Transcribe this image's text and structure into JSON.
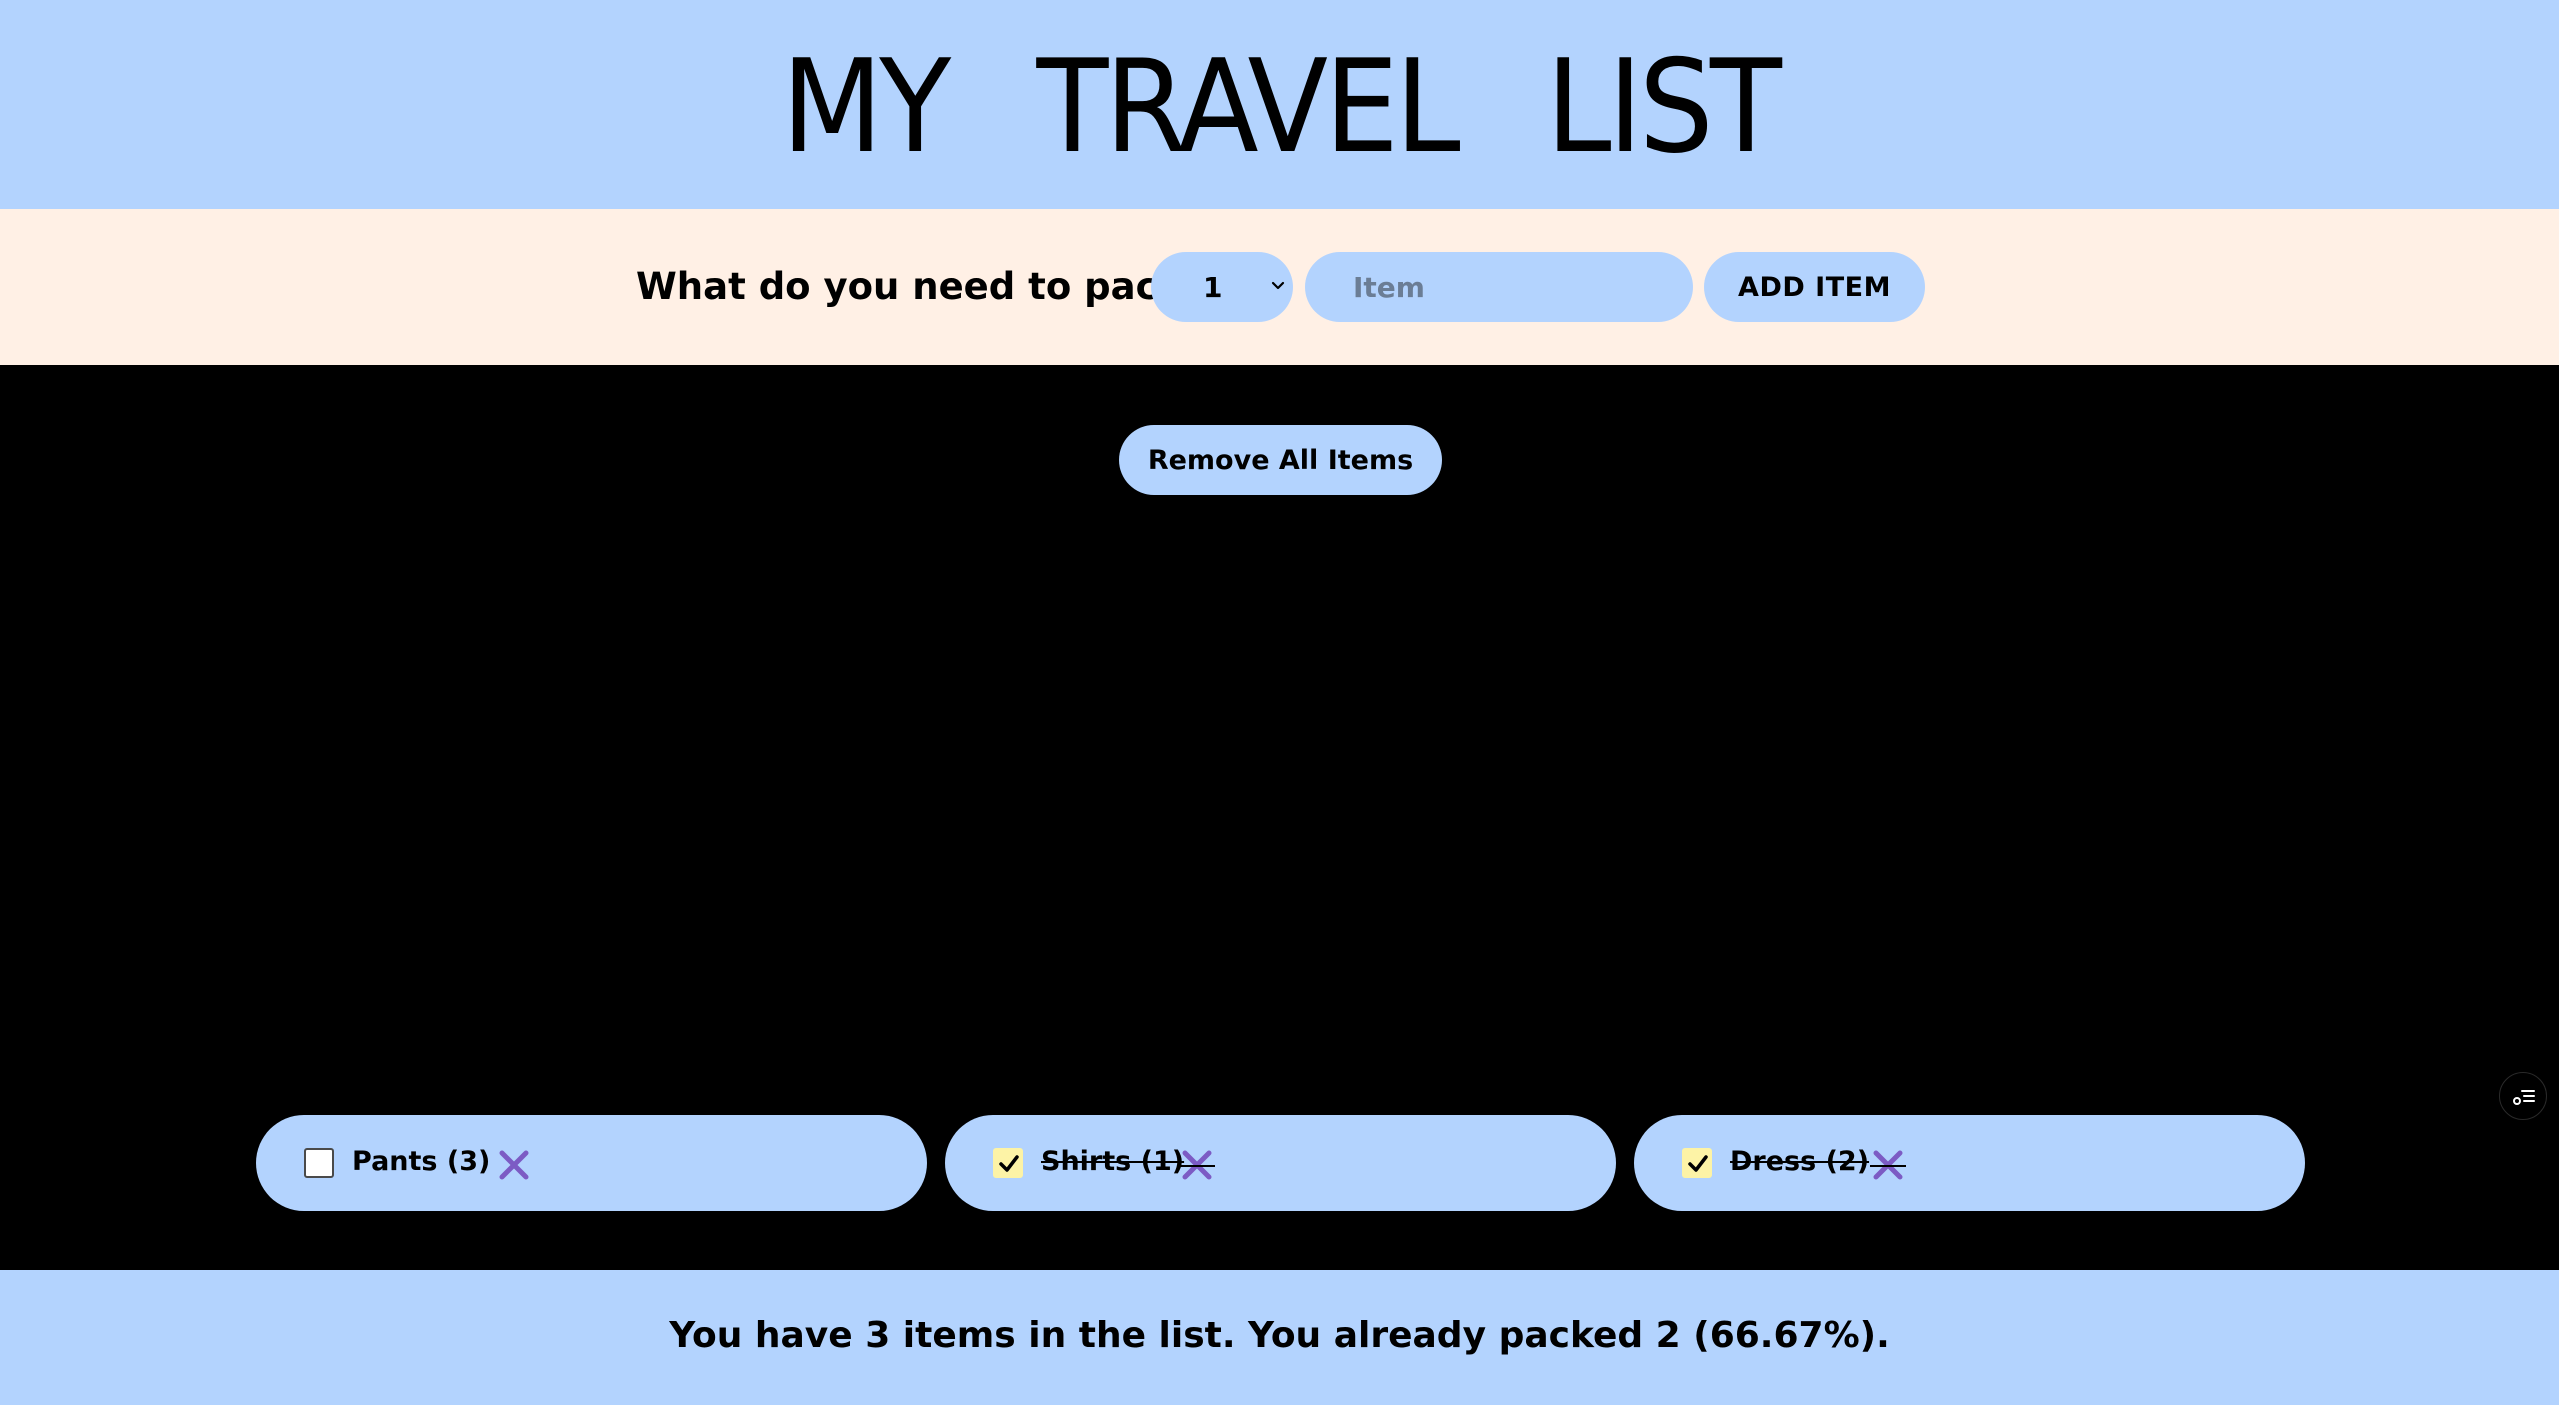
{
  "header": {
    "title": "MY TRAVEL LIST"
  },
  "form": {
    "prompt": "What do you need to pack?",
    "quantity_selected": "1",
    "item_placeholder": "Item",
    "item_value": "",
    "add_button_label": "ADD ITEM"
  },
  "main": {
    "remove_all_label": "Remove All Items",
    "items": [
      {
        "label": "Pants (3)",
        "packed": false
      },
      {
        "label": "Shirts (1)",
        "packed": true
      },
      {
        "label": "Dress (2)",
        "packed": true
      }
    ]
  },
  "footer": {
    "stats": "You have 3 items in the list. You already packed 2 (66.67%)."
  },
  "colors": {
    "header_bg": "#b3d3fe",
    "form_bg": "#fff0e5",
    "main_bg": "#000000",
    "item_bg": "#b3d3fe",
    "checkbox_checked_bg": "#fdf3a6",
    "delete_x": "#7c5bc4"
  },
  "icons": {
    "delete": "close-x-icon",
    "checkbox_check": "checkmark-icon",
    "side_panel": "list-settings-icon",
    "select_chevron": "chevron-down-icon"
  }
}
